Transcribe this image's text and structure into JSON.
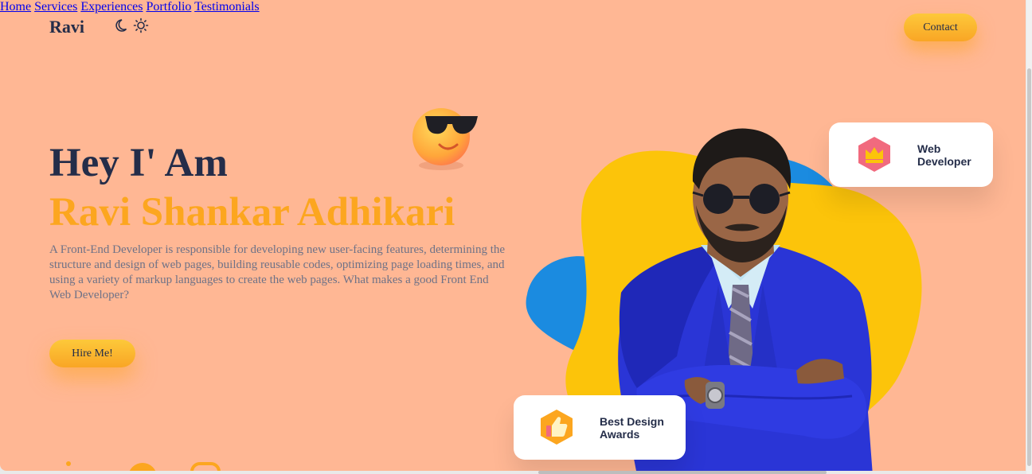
{
  "nav": {
    "logo": "Ravi",
    "links": [
      "Home",
      "Services",
      "Experiences",
      "Portfolio",
      "Testimonials"
    ],
    "contact_label": "Contact",
    "theme_icons": [
      "moon-icon",
      "sun-icon"
    ]
  },
  "hero": {
    "greeting": "Hey I' Am",
    "name": "Ravi Shankar Adhikari",
    "description": "A Front-End Developer is responsible for developing new user-facing features, determining the structure and design of web pages, building reusable codes, optimizing page loading times, and using a variety of markup languages to create the web pages. What makes a good Front End Web Developer?",
    "cta_label": "Hire Me!"
  },
  "cards": {
    "web": {
      "line1": "Web",
      "line2": "Developer",
      "icon": "crown-icon"
    },
    "award": {
      "line1": "Best Design",
      "line2": "Awards",
      "icon": "thumbs-up-icon"
    }
  },
  "colors": {
    "background": "#ffb794",
    "accent": "#fca61f",
    "dark": "#242d49",
    "blue": "#1b8be0",
    "yellow": "#fcc40a"
  }
}
